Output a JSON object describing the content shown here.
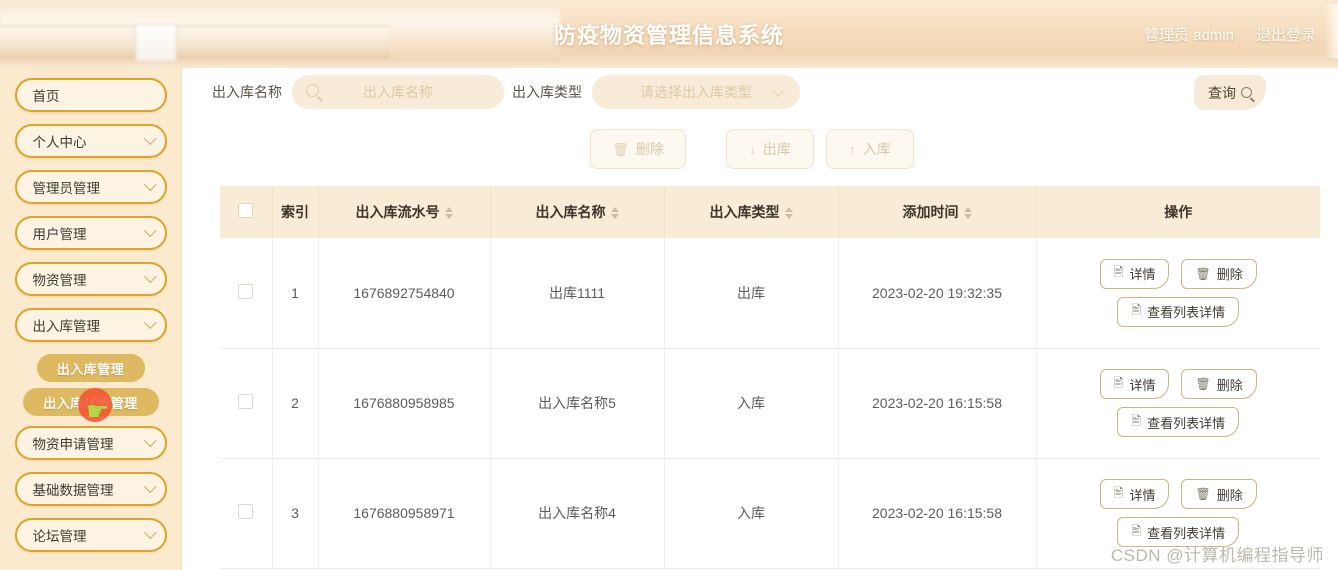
{
  "header": {
    "title": "防疫物资管理信息系统",
    "user": "管理员 admin",
    "logout": "退出登录"
  },
  "sidebar": {
    "items": [
      {
        "label": "首页",
        "has_chevron": false
      },
      {
        "label": "个人中心",
        "has_chevron": true
      },
      {
        "label": "管理员管理",
        "has_chevron": true
      },
      {
        "label": "用户管理",
        "has_chevron": true
      },
      {
        "label": "物资管理",
        "has_chevron": true
      },
      {
        "label": "出入库管理",
        "has_chevron": true
      },
      {
        "label": "物资申请管理",
        "has_chevron": true
      },
      {
        "label": "基础数据管理",
        "has_chevron": true
      },
      {
        "label": "论坛管理",
        "has_chevron": true
      }
    ],
    "submenu": [
      {
        "label": "出入库管理"
      },
      {
        "label": "出入库详情管理"
      }
    ]
  },
  "search": {
    "name_label": "出入库名称",
    "name_placeholder": "出入库名称",
    "name_value": "",
    "type_label": "出入库类型",
    "type_placeholder": "请选择出入库类型",
    "query_label": "查询"
  },
  "actions": [
    {
      "label": "删除",
      "icon": "trash-icon",
      "glyph": "☐"
    },
    {
      "label": "出库",
      "icon": "arrow-down-icon",
      "glyph": "↓"
    },
    {
      "label": "入库",
      "icon": "arrow-up-icon",
      "glyph": "↑"
    }
  ],
  "table": {
    "columns": [
      {
        "key": "checkbox",
        "label": "",
        "sortable": false
      },
      {
        "key": "index",
        "label": "索引",
        "sortable": false
      },
      {
        "key": "serial",
        "label": "出入库流水号",
        "sortable": true
      },
      {
        "key": "name",
        "label": "出入库名称",
        "sortable": true
      },
      {
        "key": "type",
        "label": "出入库类型",
        "sortable": true
      },
      {
        "key": "time",
        "label": "添加时间",
        "sortable": true
      },
      {
        "key": "ops",
        "label": "操作",
        "sortable": false
      }
    ],
    "rows": [
      {
        "index": "1",
        "serial": "1676892754840",
        "name": "出库1111",
        "type": "出库",
        "time": "2023-02-20 19:32:35"
      },
      {
        "index": "2",
        "serial": "1676880958985",
        "name": "出入库名称5",
        "type": "入库",
        "time": "2023-02-20 16:15:58"
      },
      {
        "index": "3",
        "serial": "1676880958971",
        "name": "出入库名称4",
        "type": "入库",
        "time": "2023-02-20 16:15:58"
      }
    ],
    "row_ops": {
      "detail": "详情",
      "delete": "删除",
      "list_detail": "查看列表详情"
    }
  },
  "watermark": "CSDN @计算机编程指导师",
  "colors": {
    "brand_gold": "#d9a62a",
    "header_cream": "#f6ddc0",
    "sidebar_cream": "#fbeacd",
    "submenu_gold": "#dfb961",
    "table_header": "#f9ecd6"
  }
}
